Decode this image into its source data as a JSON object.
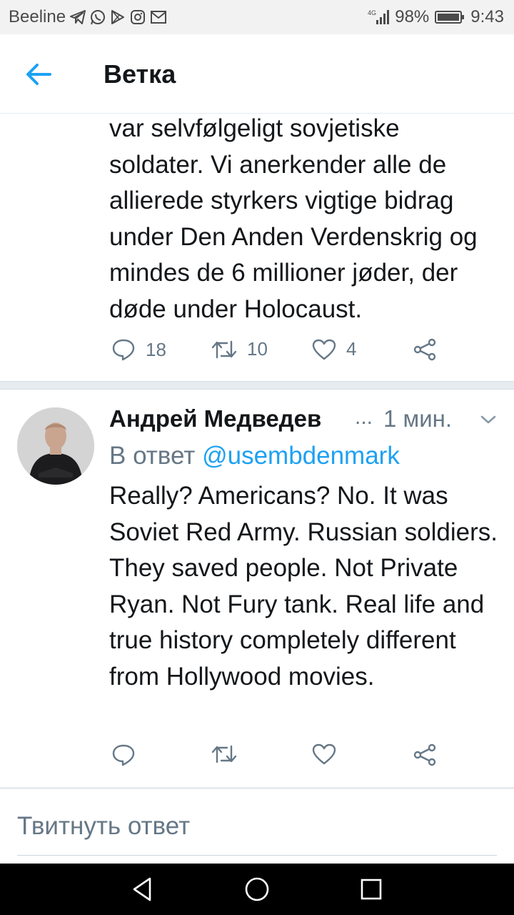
{
  "status_bar": {
    "carrier": "Beeline",
    "network": "4G",
    "battery": "98%",
    "time": "9:43",
    "icons": [
      "telegram-icon",
      "whatsapp-icon",
      "play-store-icon",
      "instagram-icon",
      "mail-icon",
      "signal-icon",
      "battery-icon"
    ]
  },
  "app_bar": {
    "title": "Ветка",
    "back_icon": "arrow-left-icon"
  },
  "tweets": [
    {
      "text": "var selvfølgeligt sovjetiske soldater. Vi anerkender alle de allierede styrkers vigtige bidrag under Den Anden Verdenskrig og mindes de 6 millioner jøder, der døde under Holocaust.",
      "replies": "18",
      "retweets": "10",
      "likes": "4"
    },
    {
      "author": "Андрей Медведев",
      "ellipsis": "...",
      "time": "1 мин.",
      "reply_prefix": "В ответ",
      "reply_handle": "@usembdenmark",
      "text": "Really? Americans? No. It was Soviet Red Army. Russian soldiers. They saved people. Not Private Ryan. Not Fury tank. Real life and true history completely different from Hollywood movies."
    }
  ],
  "compose": {
    "placeholder": "Твитнуть ответ"
  },
  "colors": {
    "accent": "#1da1f2",
    "secondary_text": "#657786",
    "primary_text": "#14171a",
    "divider": "#e6ecf0"
  }
}
